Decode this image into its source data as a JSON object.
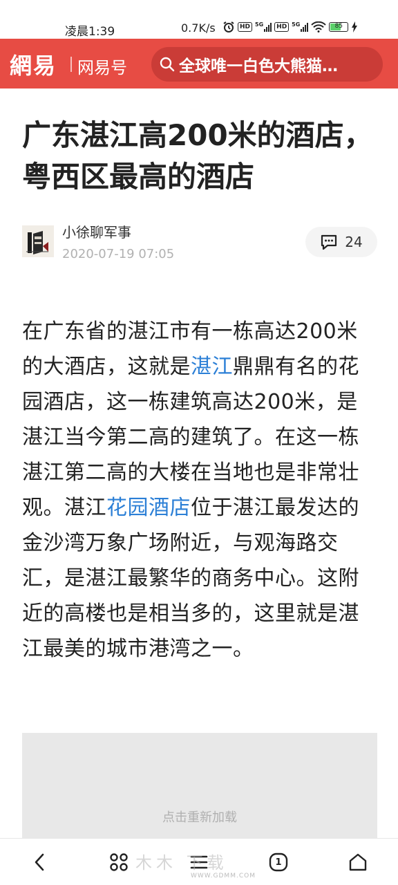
{
  "status_bar": {
    "time": "凌晨1:39",
    "net_speed": "0.7K/s",
    "net_type_1": "5G",
    "net_type_2": "5G",
    "hd_1": "HD",
    "hd_2": "HD",
    "battery": "85"
  },
  "header": {
    "logo": "網易",
    "channel": "网易号",
    "search_text": "全球唯一白色大熊猫…",
    "accent": "#e74c44"
  },
  "article": {
    "title": "广东湛江高200米的酒店，粤西区最高的酒店",
    "author": "小徐聊军事",
    "date": "2020-07-19 07:05",
    "comment_count": "24",
    "body": {
      "p1": "在广东省的湛江市有一栋高达200米的大酒店，这就是",
      "link1": "湛江",
      "p2": "鼎鼎有名的花园酒店，这一栋建筑高达200米，是湛江当今第二高的建筑了。在这一栋湛江第二高的大楼在当地也是非常壮观。湛江",
      "link2": "花园酒店",
      "p3": "位于湛江最发达的金沙湾万象广场附近，与观海路交汇，是湛江最繁华的商务中心。这附近的高楼也是相当多的，这里就是湛江最美的城市港湾之一。"
    },
    "link_color": "#2b7fd6",
    "image_reload": "点击重新加载"
  },
  "bottom_nav": {
    "tab_count": "1",
    "icons": [
      "back-icon",
      "apps-icon",
      "menu-icon",
      "tabs-icon",
      "home-icon"
    ]
  },
  "watermark": {
    "text": "木木 下载",
    "url": "WWW.GDMM.COM"
  }
}
